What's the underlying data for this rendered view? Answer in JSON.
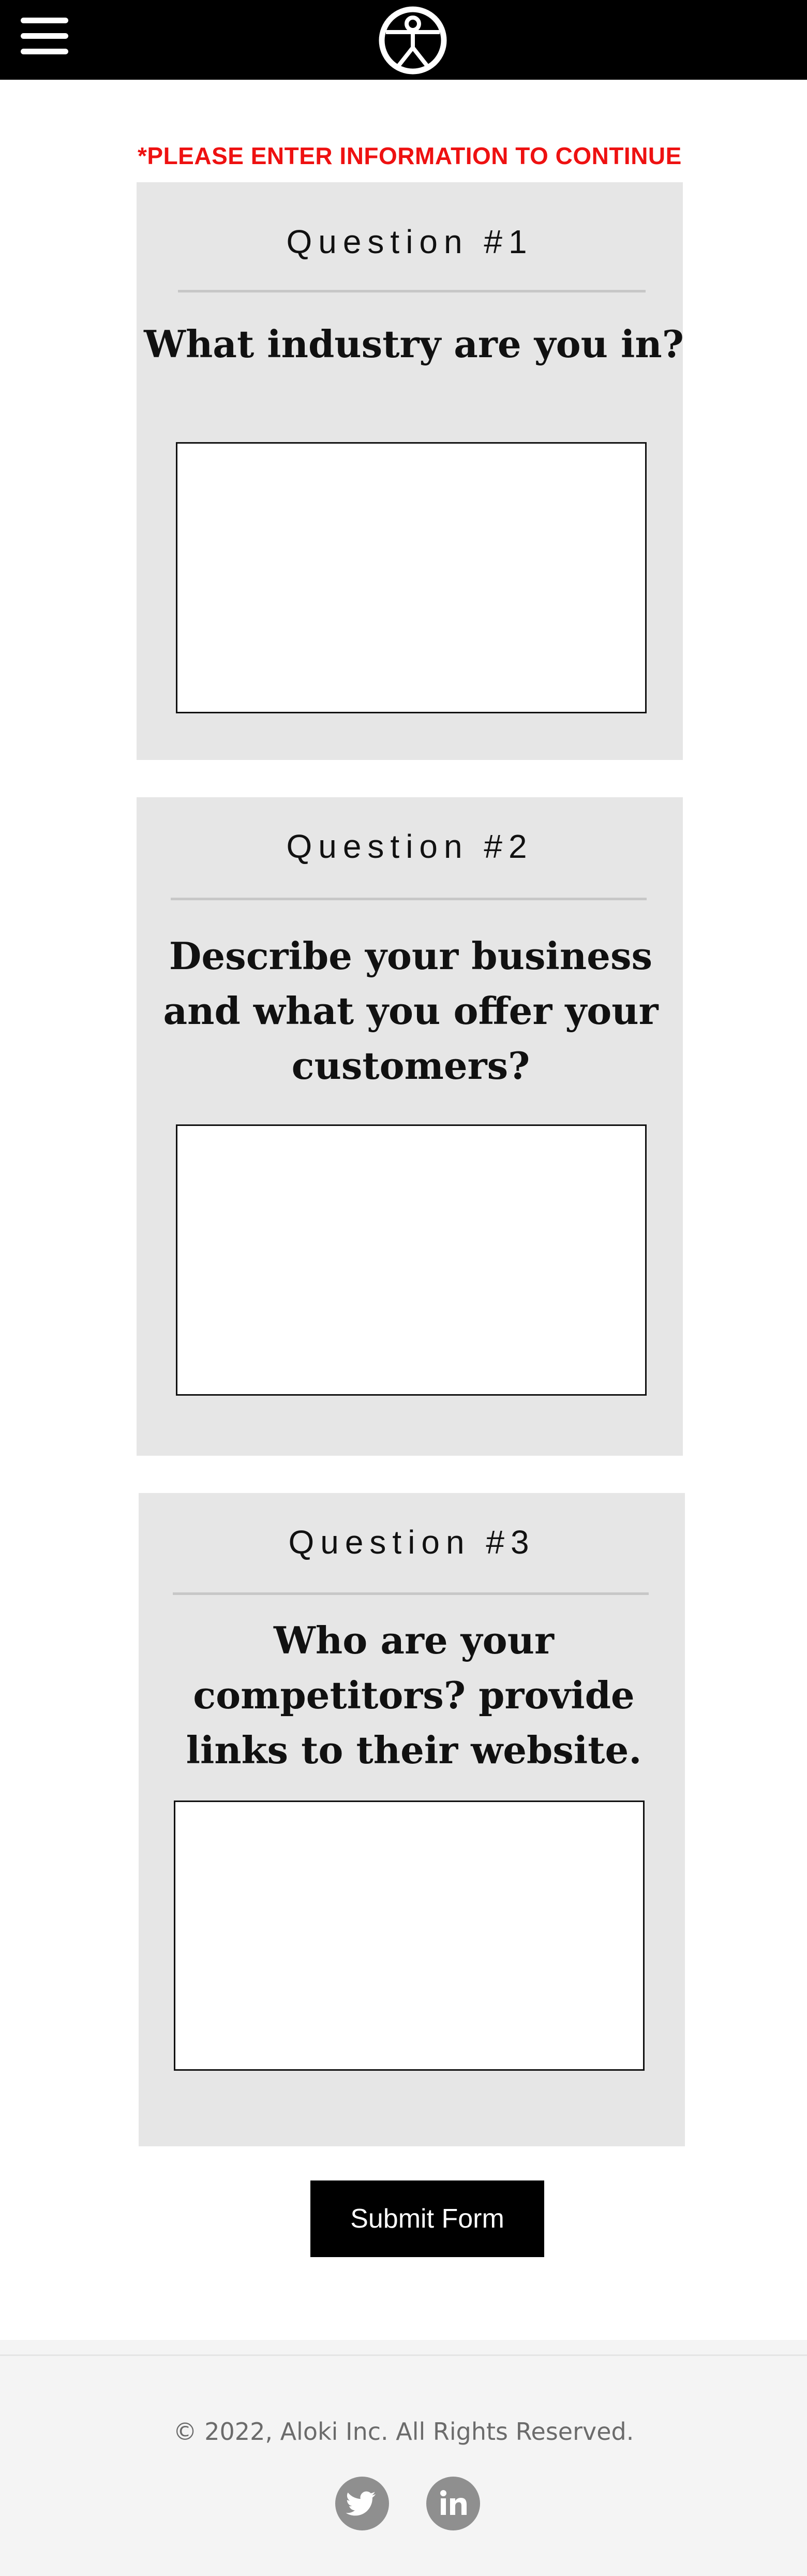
{
  "header": {
    "menu_icon": "hamburger-menu-icon",
    "logo_icon": "person-in-circle-logo-icon",
    "background": "#000000"
  },
  "form": {
    "notice": "*PLEASE ENTER INFORMATION TO CONTINUE",
    "notice_color": "#ee1111",
    "questions": [
      {
        "number": "Question #1",
        "text": "What industry are you in?",
        "answer": ""
      },
      {
        "number": "Question #2",
        "text": "Describe your business and what you offer your customers?",
        "answer": ""
      },
      {
        "number": "Question #3",
        "text": "Who are your competitors? provide links to their website.",
        "answer": ""
      }
    ],
    "submit_label": "Submit Form"
  },
  "footer": {
    "copyright": "© 2022, Aloki Inc. All Rights Reserved.",
    "social": [
      {
        "name": "twitter",
        "icon": "twitter-icon"
      },
      {
        "name": "linkedin",
        "icon": "linkedin-icon"
      }
    ]
  }
}
